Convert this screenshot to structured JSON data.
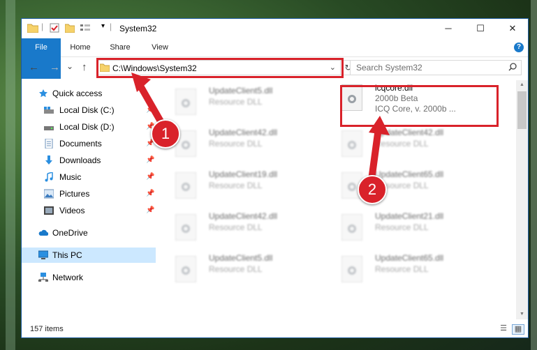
{
  "window": {
    "title": "System32",
    "controls": {
      "minimize": "─",
      "maximize": "☐",
      "close": "✕"
    }
  },
  "ribbon": {
    "tabs": [
      {
        "label": "File"
      },
      {
        "label": "Home"
      },
      {
        "label": "Share"
      },
      {
        "label": "View"
      }
    ],
    "help": "?"
  },
  "nav": {
    "back": "←",
    "forward": "→",
    "recent": "⌄",
    "up": "↑",
    "address": "C:\\Windows\\System32",
    "refresh": "↻",
    "search_placeholder": "Search System32"
  },
  "sidebar": {
    "items": [
      {
        "label": "Quick access",
        "icon": "star-icon"
      },
      {
        "label": "Local Disk (C:)",
        "icon": "drive-icon",
        "pinned": true
      },
      {
        "label": "Local Disk (D:)",
        "icon": "drive-icon",
        "pinned": true
      },
      {
        "label": "Documents",
        "icon": "documents-icon",
        "pinned": true
      },
      {
        "label": "Downloads",
        "icon": "downloads-icon",
        "pinned": true
      },
      {
        "label": "Music",
        "icon": "music-icon",
        "pinned": true
      },
      {
        "label": "Pictures",
        "icon": "pictures-icon",
        "pinned": true
      },
      {
        "label": "Videos",
        "icon": "videos-icon",
        "pinned": true
      },
      {
        "label": "OneDrive",
        "icon": "onedrive-icon"
      },
      {
        "label": "This PC",
        "icon": "pc-icon",
        "selected": true
      },
      {
        "label": "Network",
        "icon": "network-icon"
      }
    ]
  },
  "files": {
    "left_column": [
      {
        "name": "UpdateClient5.dll",
        "type": "Resource DLL"
      },
      {
        "name": "UpdateClient42.dll",
        "type": "Resource DLL"
      },
      {
        "name": "UpdateClient19.dll",
        "type": "Resource DLL"
      },
      {
        "name": "UpdateClient42.dll",
        "type": "Resource DLL"
      },
      {
        "name": "UpdateClient5.dll",
        "type": "Resource DLL"
      }
    ],
    "right_column": [
      {
        "name": "icqcore.dll",
        "version": "2000b Beta",
        "description": "ICQ Core, v. 2000b ..."
      },
      {
        "name": "UpdateClient42.dll",
        "type": "Resource DLL"
      },
      {
        "name": "UpdateClient65.dll",
        "type": "Resource DLL"
      },
      {
        "name": "UpdateClient21.dll",
        "type": "Resource DLL"
      },
      {
        "name": "UpdateClient65.dll",
        "type": "Resource DLL"
      }
    ]
  },
  "status": {
    "count": "157 items"
  },
  "annotations": {
    "step1": "1",
    "step2": "2"
  },
  "colors": {
    "accent": "#1979ca",
    "highlight_red": "#d9222a",
    "selected_bg": "#cce8ff"
  }
}
